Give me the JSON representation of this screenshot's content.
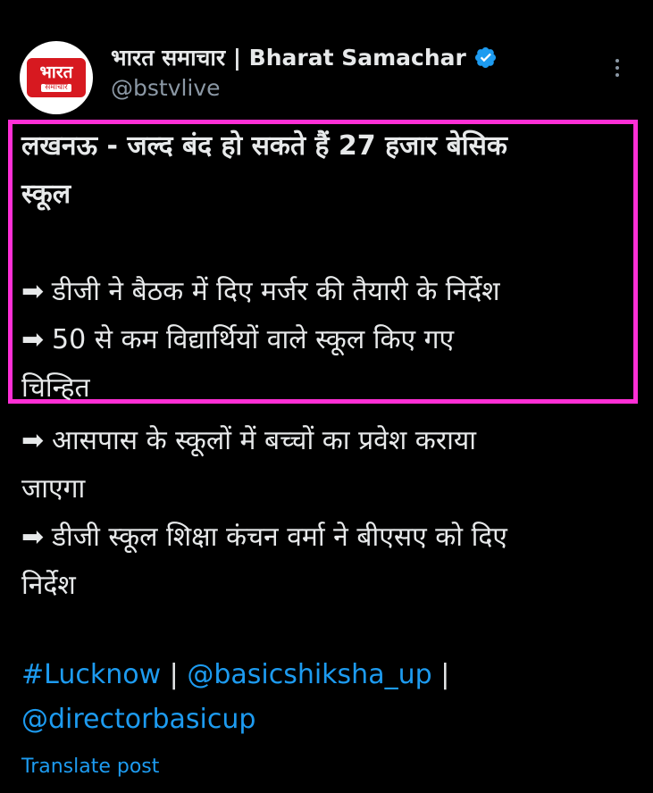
{
  "author": {
    "display_name": "भारत समाचार | Bharat Samachar",
    "handle": "@bstvlive",
    "avatar_main": "भारत",
    "avatar_sub": "समाचार"
  },
  "post": {
    "headline_line1": "लखनऊ - जल्द बंद हो सकते हैं 27 हजार बेसिक",
    "headline_line2": "स्कूल",
    "arrow": "➡",
    "bullet1": "डीजी ने बैठक में दिए मर्जर की तैयारी के निर्देश",
    "bullet2_line1": "50 से कम विद्यार्थियों वाले स्कूल किए गए",
    "bullet2_line2": "चिन्हित",
    "bullet3_line1": "आसपास के स्कूलों में बच्चों का प्रवेश कराया",
    "bullet3_line2": "जाएगा",
    "bullet4_line1": "डीजी स्कूल शिक्षा कंचन वर्मा ने बीएसए को दिए",
    "bullet4_line2": "निर्देश",
    "hashtag": "#Lucknow",
    "mention1": "@basicshiksha_up",
    "mention2": "@directorbasicup",
    "separator": "|"
  },
  "actions": {
    "translate": "Translate post"
  },
  "colors": {
    "background": "#000000",
    "link": "#1d9bf0",
    "highlight": "#ff2fd6",
    "muted": "#8b98a5"
  }
}
